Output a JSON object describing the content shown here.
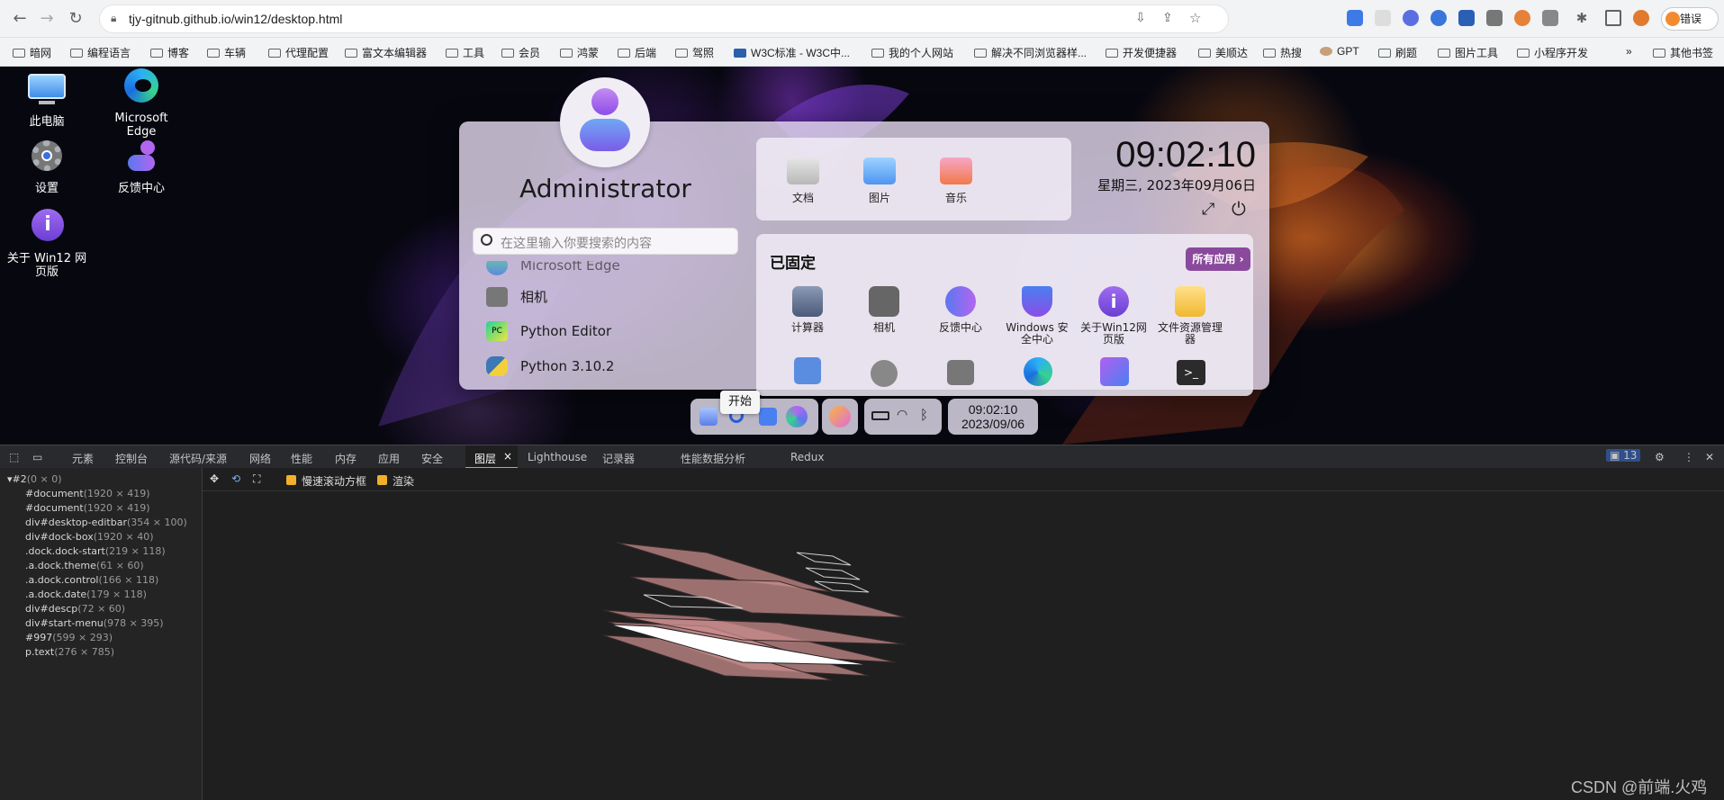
{
  "browser": {
    "url": "tjy-gitnub.github.io/win12/desktop.html",
    "error_button": "错误"
  },
  "bookmarks": [
    "暗网",
    "编程语言",
    "博客",
    "车辆",
    "代理配置",
    "富文本编辑器",
    "工具",
    "会员",
    "鸿蒙",
    "后端",
    "驾照",
    "W3C标准 - W3C中...",
    "我的个人网站",
    "解决不同浏览器样...",
    "开发便捷器",
    "美顺达",
    "热搜",
    "GPT",
    "刷题",
    "图片工具",
    "小程序开发",
    "»",
    "其他书签"
  ],
  "desktop_icons": [
    {
      "label": "此电脑",
      "icon": "computer-icon"
    },
    {
      "label": "Microsoft Edge",
      "icon": "edge-icon"
    },
    {
      "label": "设置",
      "icon": "settings-gear-icon"
    },
    {
      "label": "反馈中心",
      "icon": "feedback-icon"
    },
    {
      "label": "关于 Win12 网页版",
      "icon": "info-icon"
    }
  ],
  "start_menu": {
    "user": "Administrator",
    "search_placeholder": "在这里输入你要搜索的内容",
    "app_list": [
      "Microsoft Edge",
      "相机",
      "Python Editor",
      "Python 3.10.2"
    ],
    "quick": [
      "文档",
      "图片",
      "音乐"
    ],
    "time": "09:02:10",
    "date": "星期三, 2023年09月06日",
    "pinned_title": "已固定",
    "all_apps": "所有应用",
    "pinned": [
      "计算器",
      "相机",
      "反馈中心",
      "Windows 安全中心",
      "关于Win12网页版",
      "文件资源管理器"
    ]
  },
  "dock": {
    "tooltip": "开始",
    "time": "09:02:10",
    "date": "2023/09/06"
  },
  "devtools": {
    "tabs": [
      "元素",
      "控制台",
      "源代码/来源",
      "网络",
      "性能",
      "内存",
      "应用",
      "安全",
      "图层",
      "Lighthouse",
      "记录器",
      "性能数据分析",
      "Redux"
    ],
    "active_tab": "图层",
    "issues_count": "13",
    "toolbar": {
      "slow_scroll": "慢速滚动方框",
      "paint": "渲染"
    },
    "layers": [
      {
        "name": "#2",
        "size": "(0 × 0)"
      },
      {
        "name": "#document",
        "size": "(1920 × 419)"
      },
      {
        "name": "#document",
        "size": "(1920 × 419)"
      },
      {
        "name": "div#desktop-editbar",
        "size": "(354 × 100)"
      },
      {
        "name": "div#dock-box",
        "size": "(1920 × 40)"
      },
      {
        "name": ".dock.dock-start",
        "size": "(219 × 118)"
      },
      {
        "name": ".a.dock.theme",
        "size": "(61 × 60)"
      },
      {
        "name": ".a.dock.control",
        "size": "(166 × 118)"
      },
      {
        "name": ".a.dock.date",
        "size": "(179 × 118)"
      },
      {
        "name": "div#descp",
        "size": "(72 × 60)"
      },
      {
        "name": "div#start-menu",
        "size": "(978 × 395)"
      },
      {
        "name": "#997",
        "size": "(599 × 293)"
      },
      {
        "name": "p.text",
        "size": "(276 × 785)"
      }
    ]
  },
  "watermark": "CSDN @前端.火鸡"
}
